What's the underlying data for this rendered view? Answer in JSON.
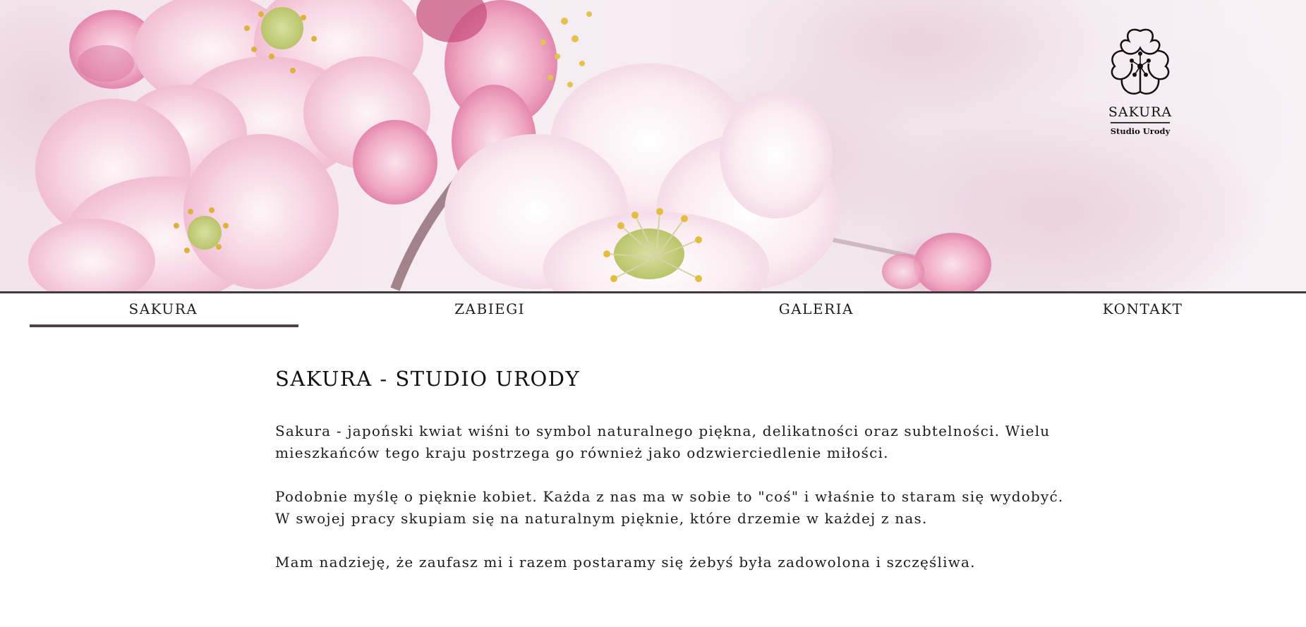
{
  "hero": {
    "image": "cherry-blossom-banner"
  },
  "logo": {
    "icon": "sakura-flower-icon",
    "title": "SAKURA",
    "subtitle": "Studio Urody"
  },
  "nav": {
    "items": [
      {
        "label": "SAKURA",
        "active": true
      },
      {
        "label": "ZABIEGI",
        "active": false
      },
      {
        "label": "GALERIA",
        "active": false
      },
      {
        "label": "KONTAKT",
        "active": false
      }
    ],
    "line_color": "#3e3a3d",
    "active_underline_color": "#4d4348"
  },
  "main": {
    "title": "SAKURA - STUDIO URODY",
    "paragraphs": [
      "Sakura - japoński kwiat wiśni to symbol naturalnego piękna, delikatności oraz subtelności. Wielu mieszkańców tego kraju postrzega go również jako odzwierciedlenie miłości.",
      "Podobnie myślę o pięknie kobiet. Każda z nas ma w sobie to \"coś\" i właśnie to staram się wydobyć. W swojej pracy skupiam się na naturalnym pięknie, które drzemie w każdej z nas.",
      "Mam nadzieję, że zaufasz mi i razem postaramy się żebyś była zadowolona i szczęśliwa."
    ]
  }
}
